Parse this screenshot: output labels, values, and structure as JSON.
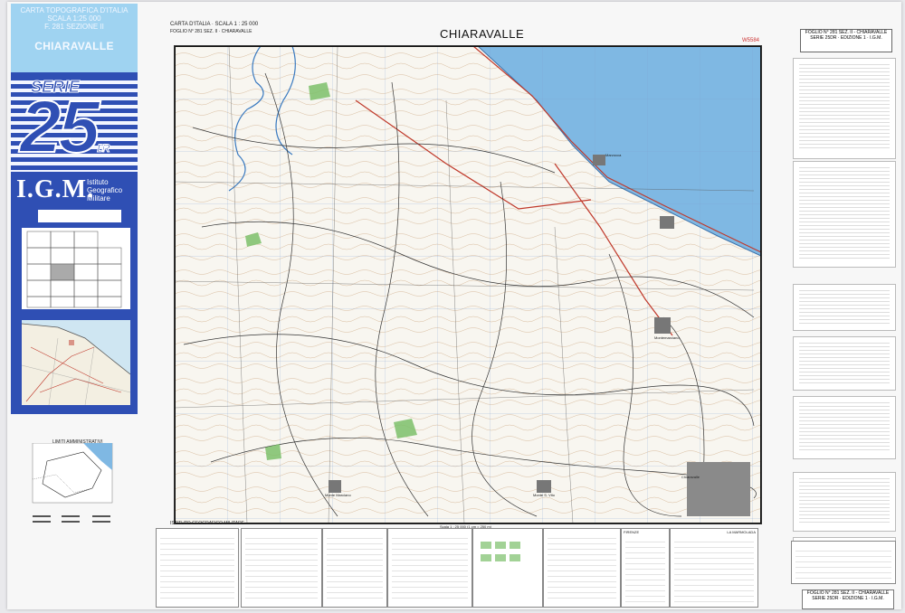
{
  "cover": {
    "line1": "CARTA TOPOGRAFICA D'ITALIA",
    "line2": "SCALA 1:25 000",
    "line3": "F. 281 SEZIONE II",
    "name": "CHIARAVALLE",
    "serie": "SERIE",
    "number": "25",
    "suffix": "DR",
    "org": "I.G.M.",
    "org_sub1": "Istituto",
    "org_sub2": "Geografico",
    "org_sub3": "Militare"
  },
  "header": {
    "left1": "CARTA D'ITALIA · SCALA 1 : 25 000",
    "left2": "FOGLIO N° 281 SEZ. II · CHIARAVALLE",
    "title": "CHIARAVALLE",
    "code": "W5584",
    "right_box1": "FOGLIO N° 281 SEZ. II - CHIARAVALLE",
    "right_box2": "SERIE 25DR · EDIZIONE 1 · I.G.M."
  },
  "places": [
    {
      "name": "Marzocca",
      "id": "marzocca"
    },
    {
      "name": "Montemarciano",
      "id": "montemarciano"
    },
    {
      "name": "Chiaravalle",
      "id": "chiaravalle"
    },
    {
      "name": "Monte S. Vito",
      "id": "montesvito"
    },
    {
      "name": "Monte Marciano",
      "id": "montemarc2"
    }
  ],
  "bottom": {
    "publisher": "ISTITUTO GEOGRAFICO MILITARE",
    "scale": "Scala 1 : 25 000  (1 cm = 250 m)",
    "firenze": "FIRENZE",
    "marmolada": "LA MARMOLADA",
    "limiti": "LIMITI AMMINISTRATIVI"
  },
  "footer": {
    "line1": "FOGLIO N° 281 SEZ. II - CHIARAVALLE",
    "line2": "SERIE 25DR · EDIZIONE 1 · I.G.M."
  },
  "colors": {
    "sea": "#7fb8e3",
    "cover": "#2f4fb4",
    "coverTop": "#9fd3f1",
    "road": "#c0392b",
    "green": "#7cbf6a"
  }
}
